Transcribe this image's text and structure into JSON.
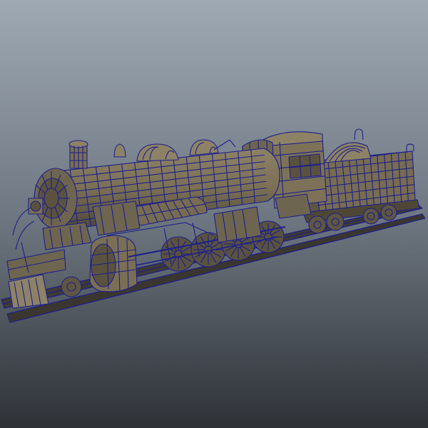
{
  "viewport": {
    "background_top": "#9fa9b3",
    "background_mid": "#6f7882",
    "background_bottom": "#2e3237"
  },
  "model": {
    "wire_color": "#1c1f8c",
    "surface_color": "#7a6f55",
    "surface_dark": "#5a523f",
    "surface_light": "#8d8266"
  }
}
